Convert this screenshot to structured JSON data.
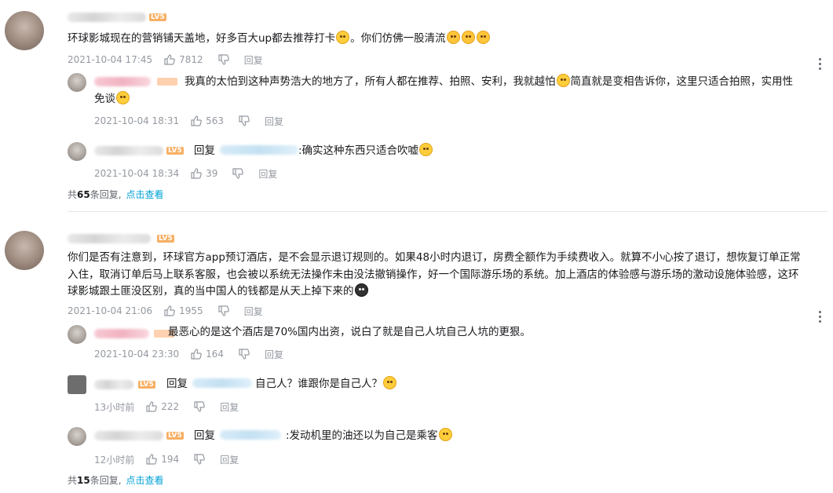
{
  "threads": [
    {
      "level": "LV5",
      "text_a": "环球影城现在的营销铺天盖地，好多百大up都去推荐打卡",
      "text_b": "。你们仿佛一股清流",
      "time": "2021-10-04 17:45",
      "likes": "7812",
      "reply_label": "回复",
      "replies": [
        {
          "text_a": "我真的太怕到这种声势浩大的地方了，所有人都在推荐、拍照、安利，我就越怕",
          "text_b": "简直就是变相告诉你，这里只适合拍照，实用性",
          "text_c": "免谈",
          "time": "2021-10-04 18:31",
          "likes": "563",
          "reply_label": "回复"
        },
        {
          "level": "LV5",
          "prefix": "回复",
          "text_a": ":确实这种东西只适合吹嘘",
          "time": "2021-10-04 18:34",
          "likes": "39",
          "reply_label": "回复"
        }
      ],
      "total_prefix": "共",
      "total_count": "65",
      "total_suffix": "条回复,",
      "total_link": "点击查看"
    },
    {
      "level": "LV5",
      "line1": "你们是否有注意到，环球官方app预订酒店，是不会显示退订规则的。如果48小时内退订，房费全额作为手续费收入。就算不小心按了退订，想恢复订单正常",
      "line2": "入住，取消订单后马上联系客服，也会被以系统无法操作未由没法撤销操作，好一个国际游乐场的系统。加上酒店的体验感与游乐场的激动设施体验感，这环",
      "line3": "球影城跟土匪没区别，真的当中国人的钱都是从天上掉下来的",
      "time": "2021-10-04 21:06",
      "likes": "1955",
      "reply_label": "回复",
      "replies": [
        {
          "text_a": "最恶心的是这个酒店是70%国内出资，说白了就是自己人坑自己人坑的更狠。",
          "time": "2021-10-04 23:30",
          "likes": "164",
          "reply_label": "回复"
        },
        {
          "level": "LV5",
          "prefix": "回复",
          "text_a": "自己人？谁跟你是自己人？",
          "time": "13小时前",
          "likes": "222",
          "reply_label": "回复"
        },
        {
          "level": "LV5",
          "prefix": "回复",
          "text_a": ":发动机里的油还以为自己是乘客",
          "time": "12小时前",
          "likes": "194",
          "reply_label": "回复"
        }
      ],
      "total_prefix": "共",
      "total_count": "15",
      "total_suffix": "条回复,",
      "total_link": "点击查看"
    }
  ],
  "colors": {
    "text": "#18191c",
    "meta": "#9499a0",
    "link": "#00a1d6",
    "level": "#f6a24a",
    "divider": "#e3e5e7"
  }
}
